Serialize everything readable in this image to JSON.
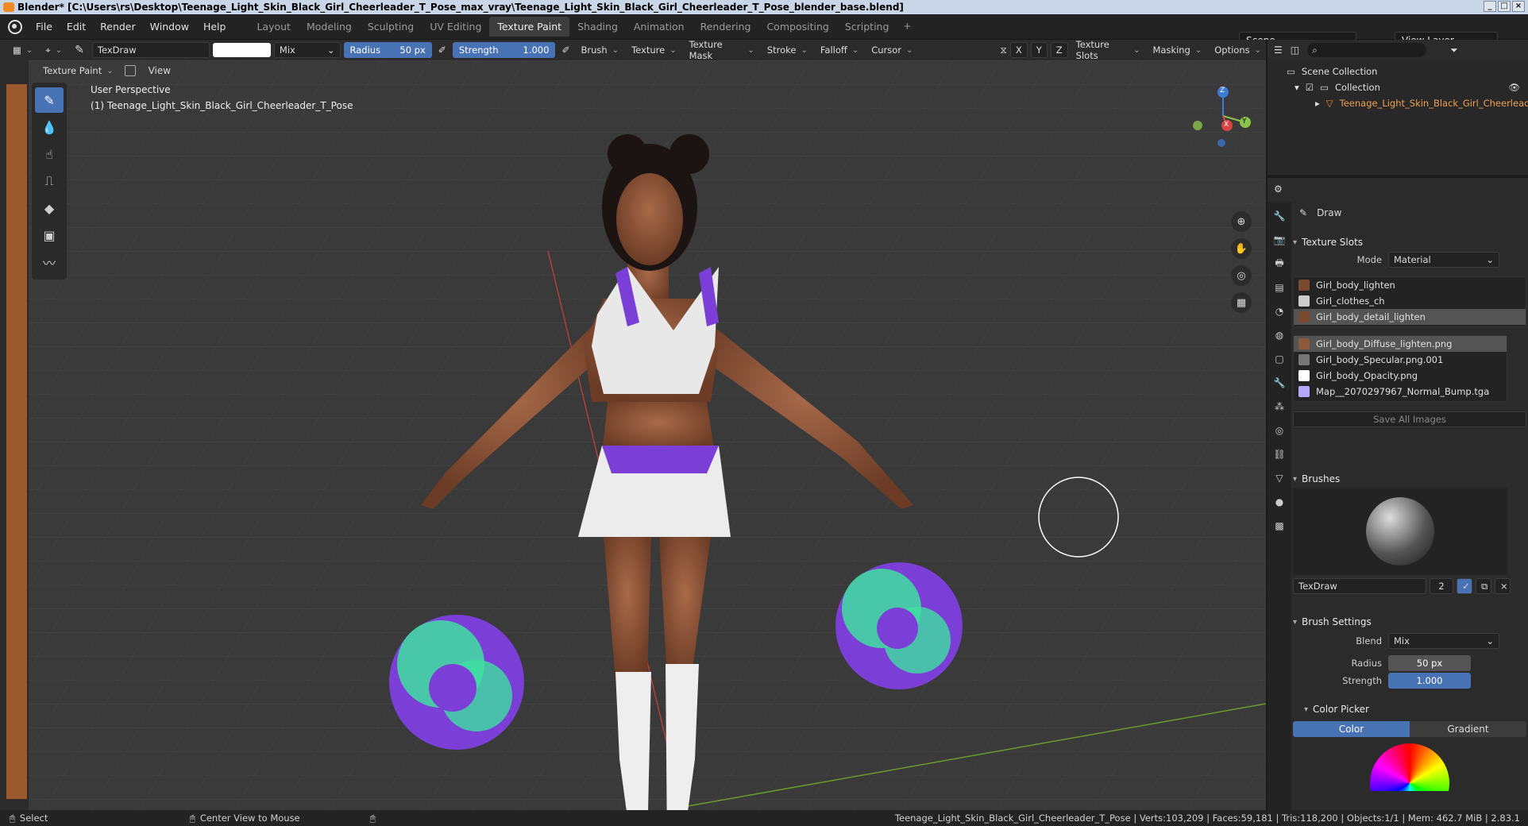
{
  "window": {
    "title": "Blender* [C:\\Users\\rs\\Desktop\\Teenage_Light_Skin_Black_Girl_Cheerleader_T_Pose_max_vray\\Teenage_Light_Skin_Black_Girl_Cheerleader_T_Pose_blender_base.blend]"
  },
  "menu": {
    "file": "File",
    "edit": "Edit",
    "render": "Render",
    "window": "Window",
    "help": "Help"
  },
  "workspaces": [
    "Layout",
    "Modeling",
    "Sculpting",
    "UV Editing",
    "Texture Paint",
    "Shading",
    "Animation",
    "Rendering",
    "Compositing",
    "Scripting"
  ],
  "active_workspace": "Texture Paint",
  "scene": {
    "name": "Scene",
    "view_layer": "View Layer"
  },
  "tool_header": {
    "brush_name": "TexDraw",
    "blend": "Mix",
    "radius_label": "Radius",
    "radius_value": "50 px",
    "strength_label": "Strength",
    "strength_value": "1.000",
    "menus": [
      "Brush",
      "Texture",
      "Texture Mask",
      "Stroke",
      "Falloff",
      "Cursor"
    ],
    "axes": [
      "X",
      "Y",
      "Z"
    ],
    "right_menus": [
      "Texture Slots",
      "Masking",
      "Options"
    ]
  },
  "viewport_header": {
    "mode": "Texture Paint",
    "view": "View"
  },
  "viewport": {
    "perspective": "User Perspective",
    "object_label": "(1) Teenage_Light_Skin_Black_Girl_Cheerleader_T_Pose",
    "gizmo": {
      "z": "Z",
      "y": "Y",
      "x": "X"
    }
  },
  "outliner": {
    "scene_collection": "Scene Collection",
    "collection": "Collection",
    "object": "Teenage_Light_Skin_Black_Girl_Cheerleader"
  },
  "properties": {
    "active_tool": "Draw",
    "texture_slots": {
      "header": "Texture Slots",
      "mode_label": "Mode",
      "mode_value": "Material",
      "materials": [
        "Girl_body_lighten",
        "Girl_clothes_ch",
        "Girl_body_detail_lighten"
      ],
      "images": [
        "Girl_body_Diffuse_lighten.png",
        "Girl_body_Specular.png.001",
        "Girl_body_Opacity.png",
        "Map__2070297967_Normal_Bump.tga"
      ],
      "save_all": "Save All Images"
    },
    "brushes": {
      "header": "Brushes",
      "name": "TexDraw",
      "users": "2"
    },
    "brush_settings": {
      "header": "Brush Settings",
      "blend_label": "Blend",
      "blend_value": "Mix",
      "radius_label": "Radius",
      "radius_value": "50 px",
      "strength_label": "Strength",
      "strength_value": "1.000"
    },
    "color_picker": {
      "header": "Color Picker",
      "color_tab": "Color",
      "gradient_tab": "Gradient"
    }
  },
  "status": {
    "select": "Select",
    "center_view": "Center View to Mouse",
    "stats": "Teenage_Light_Skin_Black_Girl_Cheerleader_T_Pose | Verts:103,209 | Faces:59,181 | Tris:118,200 | Objects:1/1 | Mem: 462.7 MiB | 2.83.1"
  },
  "colors": {
    "accent": "#4772b3",
    "orange": "#f08a24",
    "pom_green": "#3fe0a0",
    "pom_purple": "#7b3fd8"
  }
}
